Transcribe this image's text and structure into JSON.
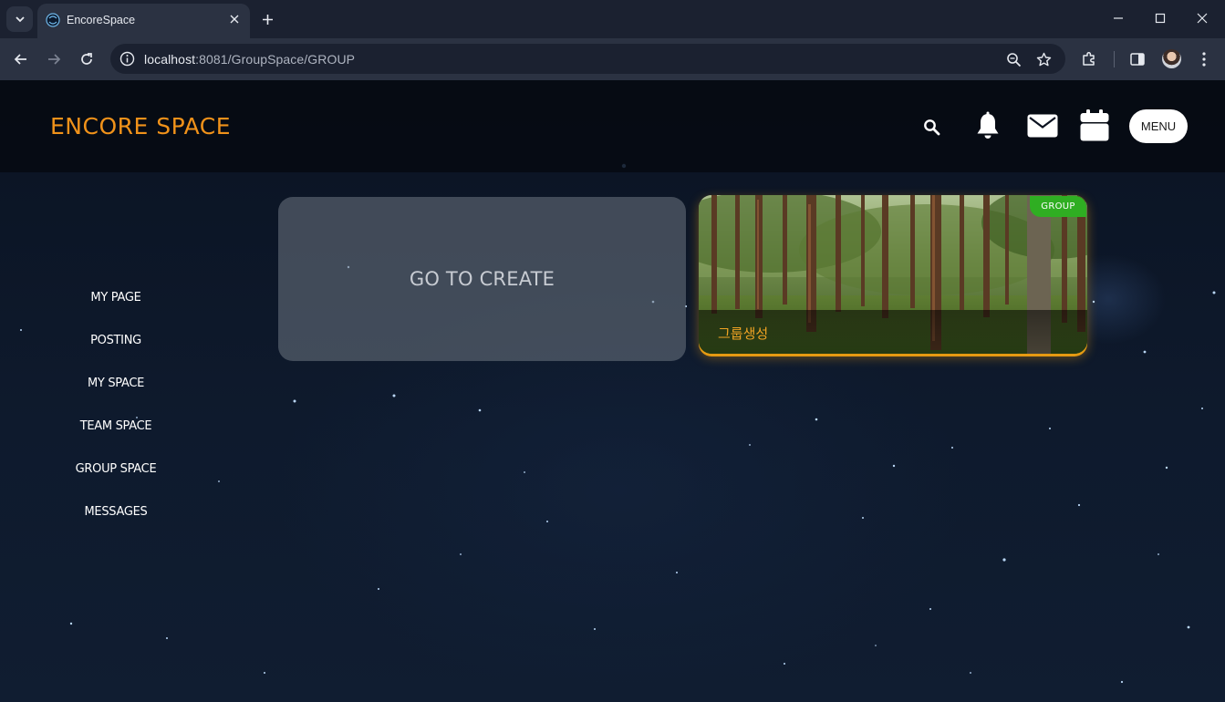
{
  "browser": {
    "tab_title": "EncoreSpace",
    "url_host": "localhost",
    "url_rest": ":8081/GroupSpace/GROUP"
  },
  "header": {
    "logo": "ENCORE SPACE",
    "menu_label": "MENU"
  },
  "sidebar": {
    "items": [
      {
        "label": "MY PAGE"
      },
      {
        "label": "POSTING"
      },
      {
        "label": "MY SPACE"
      },
      {
        "label": "TEAM SPACE"
      },
      {
        "label": "GROUP SPACE"
      },
      {
        "label": "MESSAGES"
      }
    ]
  },
  "main": {
    "create_label": "GO TO CREATE",
    "cards": [
      {
        "title": "그룹생성",
        "badge": "GROUP"
      }
    ]
  },
  "colors": {
    "accent": "#f0921a",
    "badge": "#2fae22",
    "card_glow": "#e59a12"
  }
}
